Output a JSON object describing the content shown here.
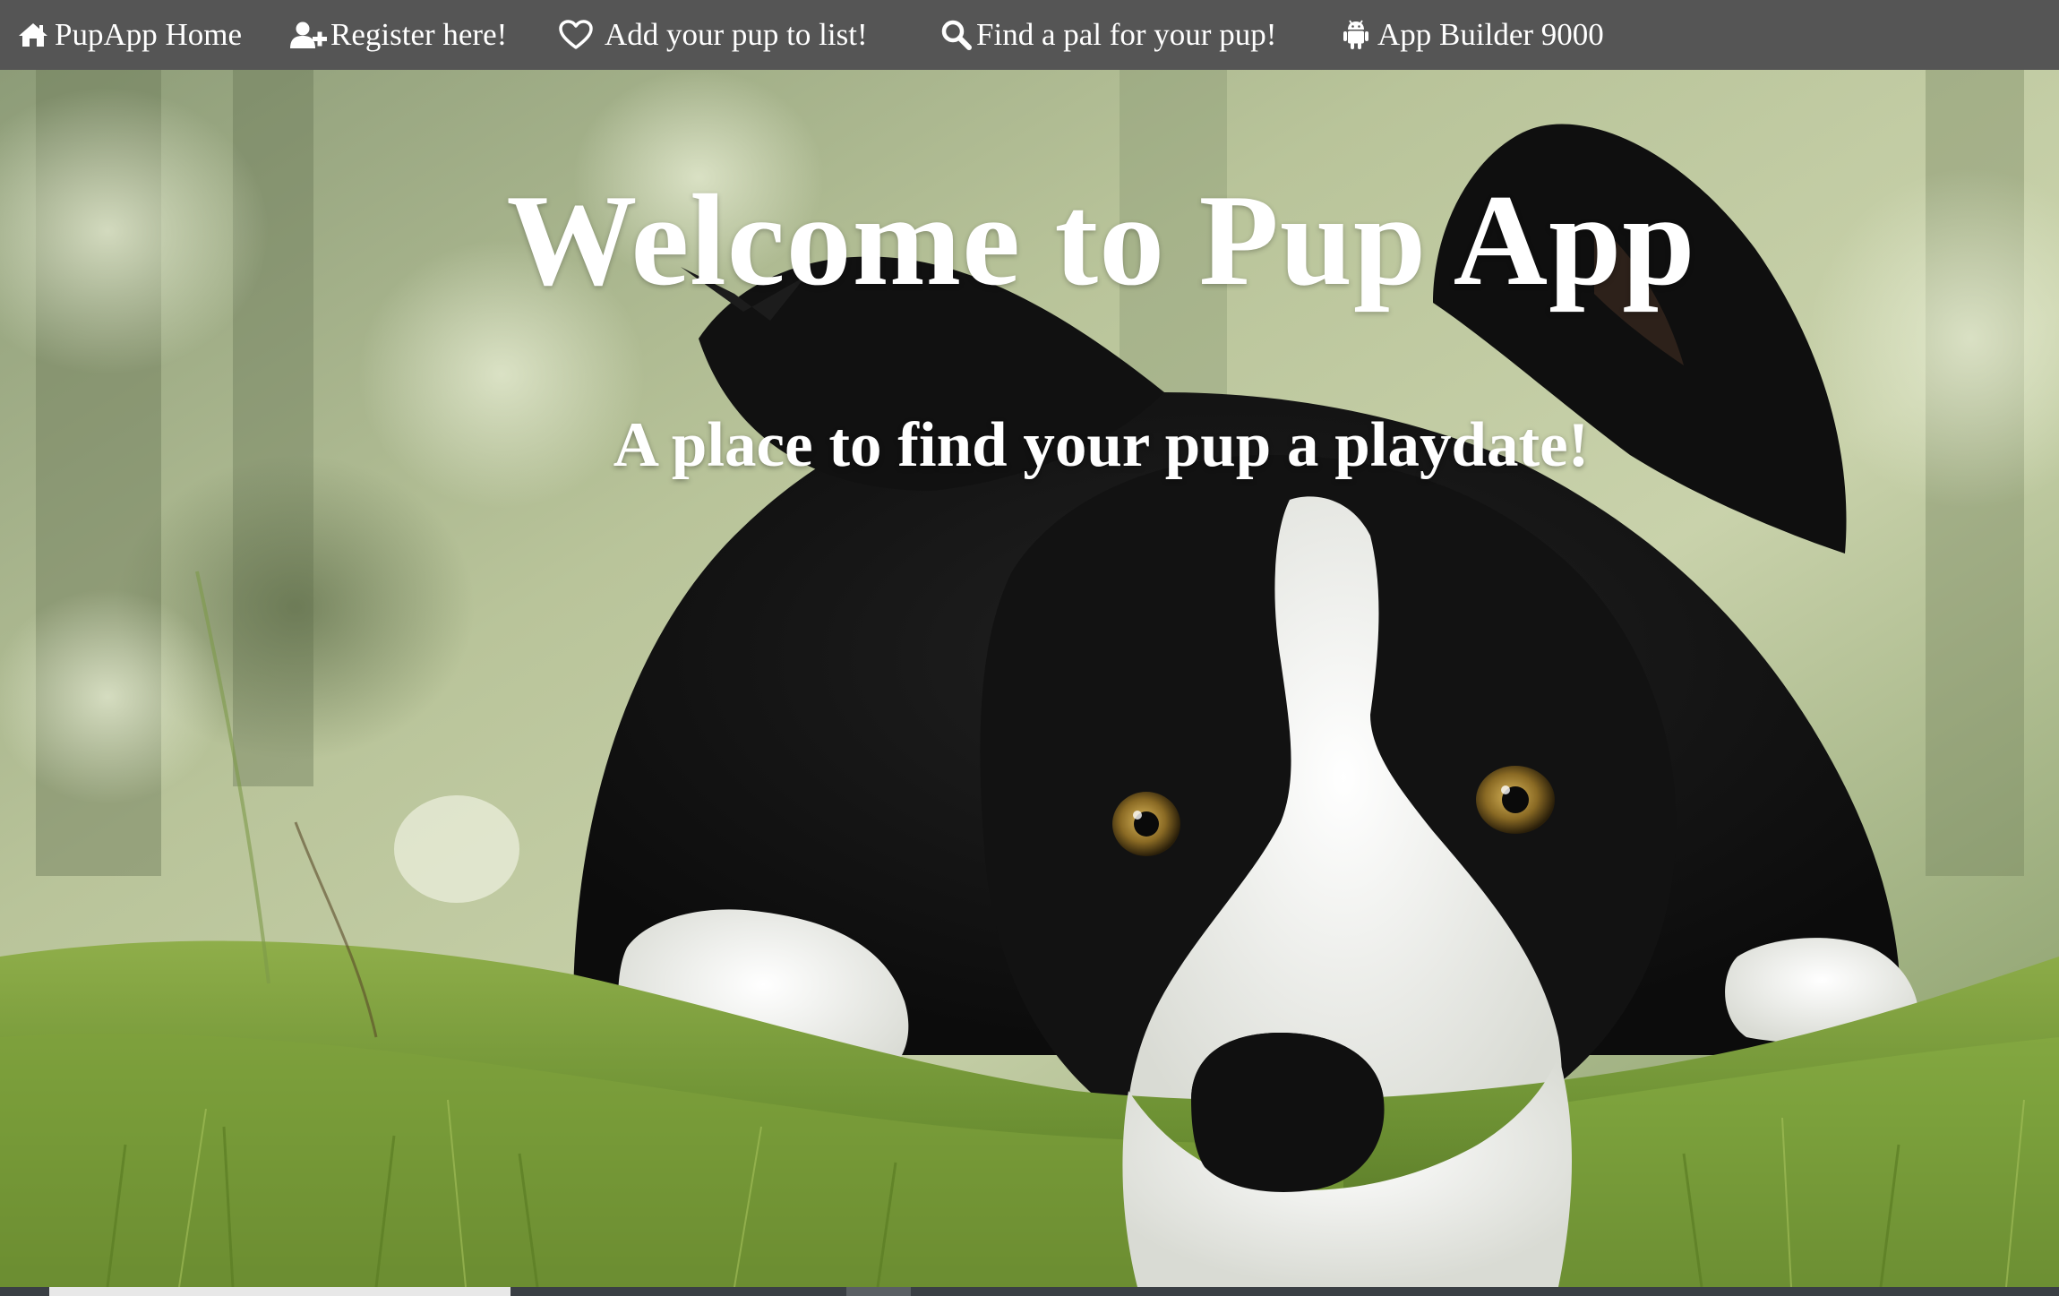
{
  "nav": {
    "items": [
      {
        "label": "PupApp Home",
        "icon": "home-icon"
      },
      {
        "label": "Register here!",
        "icon": "user-plus-icon"
      },
      {
        "label": "Add your pup to list!",
        "icon": "heart-outline-icon"
      },
      {
        "label": "Find a pal for your pup!",
        "icon": "search-icon"
      },
      {
        "label": "App Builder 9000",
        "icon": "android-icon"
      }
    ]
  },
  "hero": {
    "title": "Welcome to Pup App",
    "subtitle": "A place to find your pup a playdate!",
    "image": "border-collie-lying-in-grass"
  },
  "colors": {
    "navbar": "#555555",
    "nav_text": "#ffffff",
    "hero_text": "#ffffff"
  }
}
